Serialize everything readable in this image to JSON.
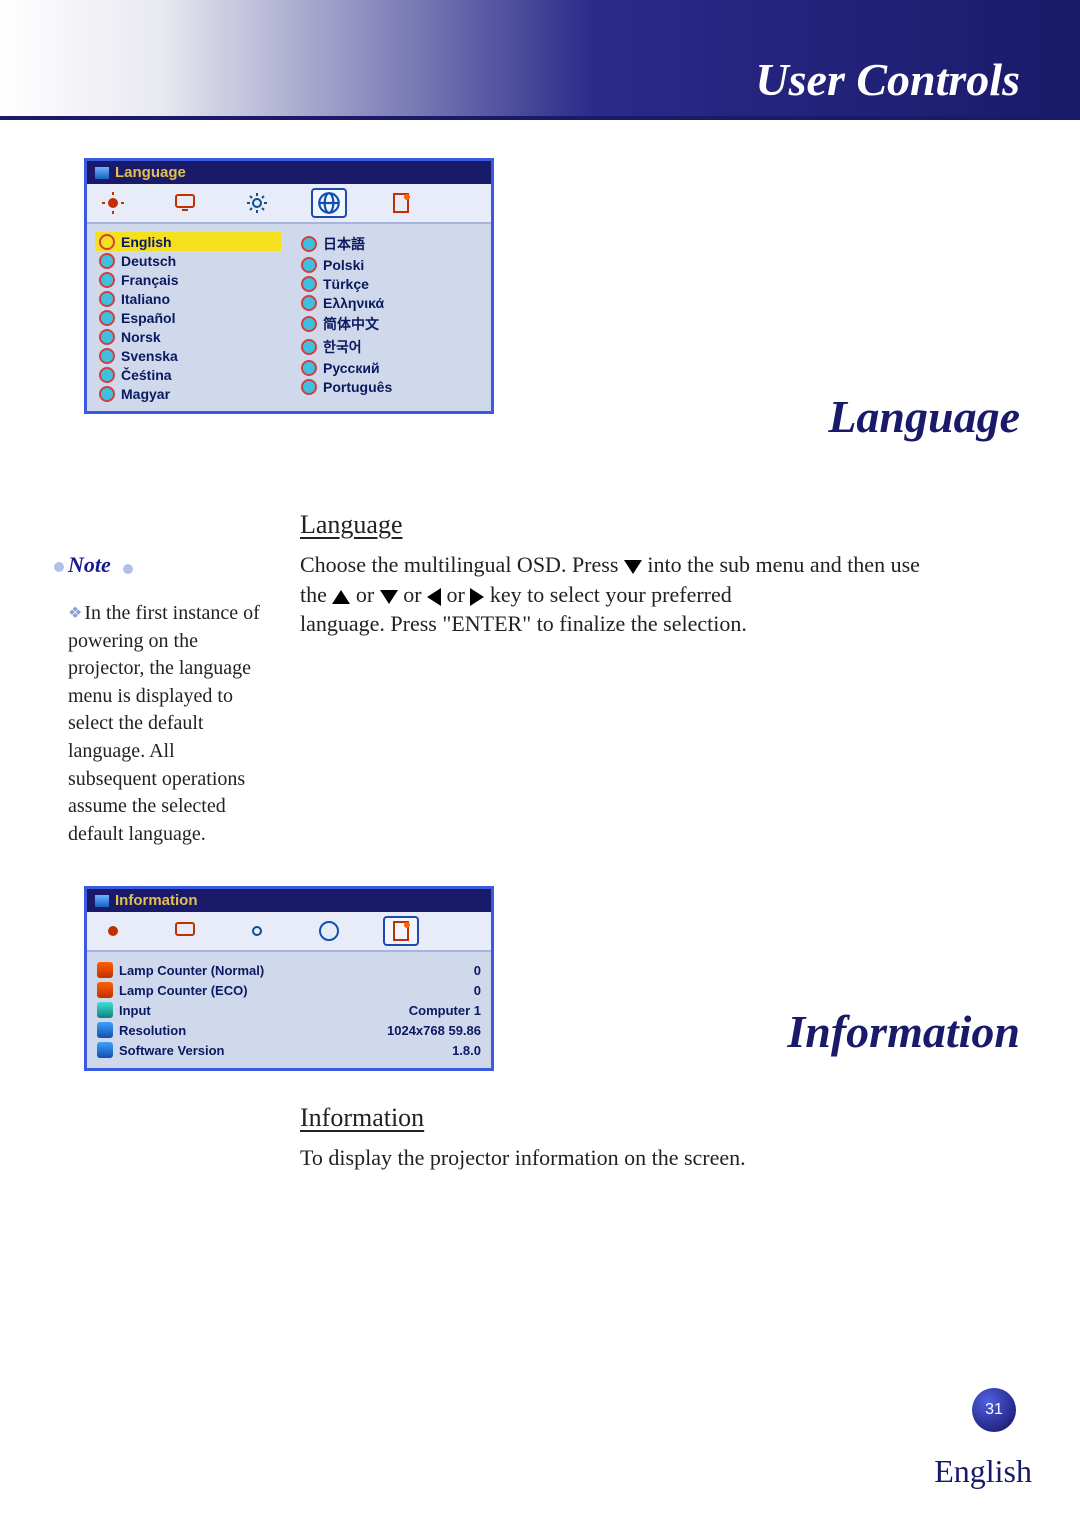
{
  "header": {
    "title": "User Controls"
  },
  "osd_language": {
    "title": "Language",
    "tabs": [
      "image-tab",
      "screen-tab",
      "settings-tab",
      "language-tab",
      "info-tab"
    ],
    "selected_tab_index": 3,
    "left_column": [
      "English",
      "Deutsch",
      "Français",
      "Italiano",
      "Español",
      "Norsk",
      "Svenska",
      "Čeśtina",
      "Magyar"
    ],
    "right_column": [
      "日本語",
      "Polski",
      "Türkçe",
      "Ελληνικά",
      "简体中文",
      "한국어",
      "Русский",
      "Português"
    ],
    "selected_language": "English"
  },
  "section_language": {
    "big_title": "Language",
    "heading": "Language",
    "body_part1": "Choose the multilingual OSD. Press ",
    "body_part2": " into the sub menu and then use the ",
    "body_or1": " or ",
    "body_or2": " or ",
    "body_or3": " or ",
    "body_part3": "key to select your preferred",
    "body_part4": "language. Press \"ENTER\" to finalize the selection."
  },
  "note": {
    "label": "Note",
    "text": "In the first instance of powering on the projector, the language menu is displayed to select the default language. All subsequent operations assume the selected default language."
  },
  "osd_info": {
    "title": "Information",
    "rows": [
      {
        "label": "Lamp Counter (Normal)",
        "value": "0"
      },
      {
        "label": "Lamp Counter (ECO)",
        "value": "0"
      },
      {
        "label": "Input",
        "value": "Computer 1"
      },
      {
        "label": "Resolution",
        "value": "1024x768  59.86"
      },
      {
        "label": "Software Version",
        "value": "1.8.0"
      }
    ],
    "selected_tab_index": 4
  },
  "section_info": {
    "big_title": "Information",
    "heading": "Information",
    "body": "To display the projector information on the screen."
  },
  "footer": {
    "page_number": "31",
    "language": "English"
  }
}
